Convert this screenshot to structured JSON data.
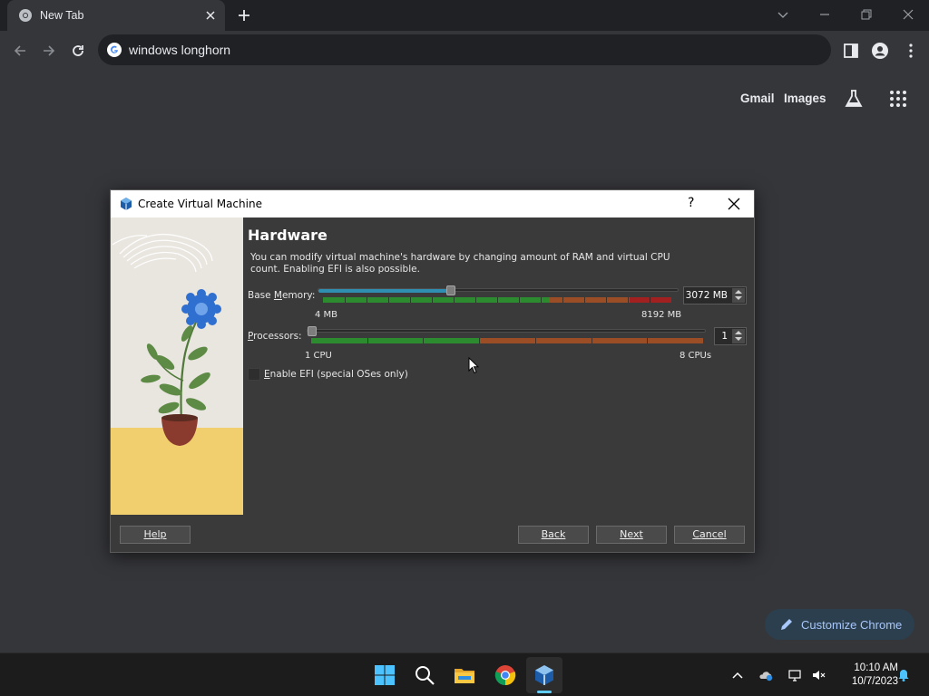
{
  "browser": {
    "tab": {
      "title": "New Tab",
      "favicon": "chrome-icon"
    },
    "address_bar": {
      "value": "windows longhorn",
      "icon": "google-g-icon"
    },
    "header_links": {
      "gmail": "Gmail",
      "images": "Images"
    },
    "customize_button": "Customize Chrome"
  },
  "dialog": {
    "title": "Create Virtual Machine",
    "help_glyph": "?",
    "heading": "Hardware",
    "description": "You can modify virtual machine's hardware by changing amount of RAM and virtual CPU count. Enabling EFI is also possible.",
    "memory": {
      "label_prefix": "Base ",
      "label_underlined": "M",
      "label_suffix": "emory:",
      "value": "3072 MB",
      "min_label": "4 MB",
      "max_label": "8192 MB",
      "current_mb": 3072,
      "min_mb": 4,
      "max_mb": 8192
    },
    "processors": {
      "label_underlined": "P",
      "label_suffix": "rocessors:",
      "value": "1",
      "min_label": "1 CPU",
      "max_label": "8 CPUs",
      "current": 1,
      "min": 1,
      "max": 8
    },
    "efi": {
      "label_prefix": "",
      "label_underlined": "E",
      "label_suffix": "nable EFI (special OSes only)",
      "checked": false
    },
    "buttons": {
      "help": "Help",
      "back": "Back",
      "next": "Next",
      "cancel": "Cancel"
    }
  },
  "taskbar": {
    "apps": [
      "start-icon",
      "search-icon",
      "file-explorer-icon",
      "chrome-icon",
      "virtualbox-icon"
    ],
    "active_app": "virtualbox-icon",
    "clock": {
      "time": "10:10 AM",
      "date": "10/7/2023"
    }
  },
  "colors": {
    "chrome_bg": "#35363a",
    "tabstrip_bg": "#202124",
    "dialog_bg": "#3a3a3a",
    "slider_accent": "#2e8fb3",
    "range_green": "#2c8a2f",
    "range_orange": "#9b4d25",
    "range_red": "#a32020",
    "customize_text": "#a8c7fa"
  }
}
